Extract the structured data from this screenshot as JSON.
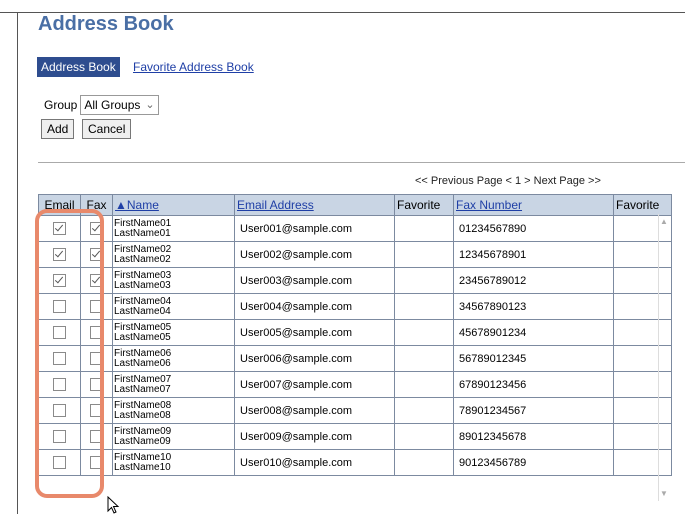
{
  "page": {
    "title": "Address Book",
    "tabs": [
      {
        "label": "Address Book",
        "active": true
      },
      {
        "label": "Favorite Address Book",
        "active": false
      }
    ],
    "group_label": "Group",
    "group_value": "All Groups",
    "buttons": {
      "add": "Add",
      "cancel": "Cancel"
    },
    "pager": "<< Previous Page < 1 > Next Page >>"
  },
  "table": {
    "headers": {
      "email": "Email",
      "fax": "Fax",
      "name": "▲Name",
      "email_address": "Email Address",
      "favorite1": "Favorite",
      "fax_number": "Fax Number",
      "favorite2": "Favorite"
    },
    "rows": [
      {
        "first": "FirstName01",
        "last": "LastName01",
        "email": "User001@sample.com",
        "fax": "01234567890",
        "email_checked": true,
        "fax_checked": true
      },
      {
        "first": "FirstName02",
        "last": "LastName02",
        "email": "User002@sample.com",
        "fax": "12345678901",
        "email_checked": true,
        "fax_checked": true
      },
      {
        "first": "FirstName03",
        "last": "LastName03",
        "email": "User003@sample.com",
        "fax": "23456789012",
        "email_checked": true,
        "fax_checked": true
      },
      {
        "first": "FirstName04",
        "last": "LastName04",
        "email": "User004@sample.com",
        "fax": "34567890123",
        "email_checked": false,
        "fax_checked": false
      },
      {
        "first": "FirstName05",
        "last": "LastName05",
        "email": "User005@sample.com",
        "fax": "45678901234",
        "email_checked": false,
        "fax_checked": false
      },
      {
        "first": "FirstName06",
        "last": "LastName06",
        "email": "User006@sample.com",
        "fax": "56789012345",
        "email_checked": false,
        "fax_checked": false
      },
      {
        "first": "FirstName07",
        "last": "LastName07",
        "email": "User007@sample.com",
        "fax": "67890123456",
        "email_checked": false,
        "fax_checked": false
      },
      {
        "first": "FirstName08",
        "last": "LastName08",
        "email": "User008@sample.com",
        "fax": "78901234567",
        "email_checked": false,
        "fax_checked": false
      },
      {
        "first": "FirstName09",
        "last": "LastName09",
        "email": "User009@sample.com",
        "fax": "89012345678",
        "email_checked": false,
        "fax_checked": false
      },
      {
        "first": "FirstName10",
        "last": "LastName10",
        "email": "User010@sample.com",
        "fax": "90123456789",
        "email_checked": false,
        "fax_checked": false
      }
    ]
  },
  "colors": {
    "title": "#4a6fa5",
    "active_tab_bg": "#2e4d8f",
    "link": "#1f3fa6",
    "header_bg": "#c9d5e4",
    "highlight": "#e8896b"
  },
  "icons": {
    "select_arrow": "chevron-down-icon",
    "checkbox": "checkbox-icon",
    "pointer": "mouse-pointer-icon"
  }
}
